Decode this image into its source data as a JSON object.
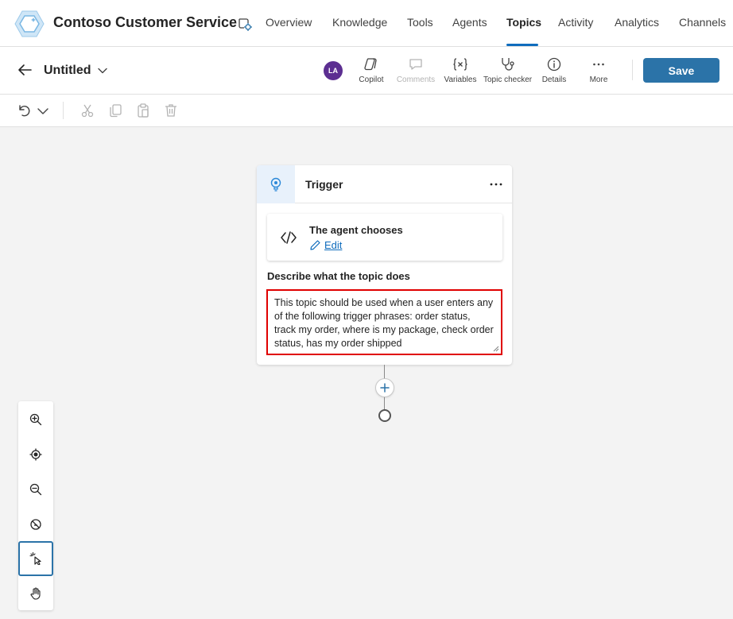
{
  "app": {
    "title": "Contoso Customer Service",
    "logo_icon": "agent-hexagon-icon",
    "accent": "#0f6cbd"
  },
  "nav": {
    "tabs": [
      {
        "label": "Overview",
        "active": false
      },
      {
        "label": "Knowledge",
        "active": false
      },
      {
        "label": "Tools",
        "active": false
      },
      {
        "label": "Agents",
        "active": false
      },
      {
        "label": "Topics",
        "active": true
      },
      {
        "label": "Activity",
        "active": false
      },
      {
        "label": "Analytics",
        "active": false
      },
      {
        "label": "Channels",
        "active": false
      }
    ]
  },
  "command_bar": {
    "topic_title": "Untitled",
    "avatar_initials": "LA",
    "avatar_color": "#5c2e91",
    "copilot_label": "Copilot",
    "comments_label": "Comments",
    "variables_label": "Variables",
    "topic_checker_label": "Topic checker",
    "details_label": "Details",
    "more_label": "More",
    "save_label": "Save",
    "save_color": "#2b73a8"
  },
  "edit_toolbar": {
    "icons": [
      "undo-icon",
      "chevron-down-icon",
      "cut-icon",
      "copy-icon",
      "paste-icon",
      "delete-icon"
    ]
  },
  "trigger": {
    "title": "Trigger",
    "chooser_title": "The agent chooses",
    "edit_label": "Edit",
    "description_label": "Describe what the topic does",
    "description_value": "This topic should be used when a user enters any of the following trigger phrases: order status, track my order, where is my package, check order status, has my order shipped",
    "highlight_color": "#e00000"
  },
  "zoom_controls": {
    "icons": [
      "zoom-in-icon",
      "fit-view-icon",
      "zoom-out-icon",
      "minimap-off-icon",
      "select-pointer-icon",
      "pan-hand-icon"
    ],
    "selected": "select-pointer-icon"
  }
}
